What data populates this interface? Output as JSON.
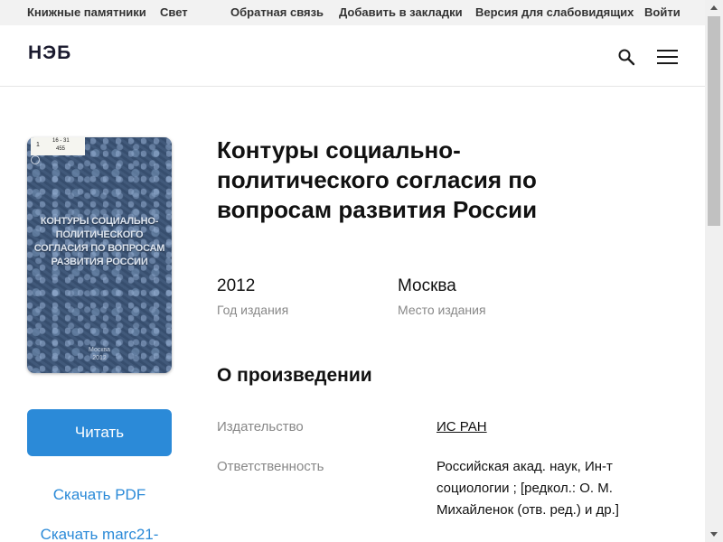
{
  "topbar": {
    "items": [
      "Книжные памятники",
      "Свет",
      "Обратная связь",
      "Добавить в закладки",
      "Версия для слабовидящих",
      "Войти"
    ]
  },
  "header": {
    "logo": "НЭБ",
    "search_icon": "search-icon",
    "menu_icon": "hamburger-menu-icon"
  },
  "cover": {
    "label_num": "1",
    "label_code_top": "16 - 31",
    "label_code_bottom": "455",
    "title": "Контуры социально-политического согласия по вопросам развития России",
    "city": "Москва",
    "year_small": "2012"
  },
  "actions": {
    "read": "Читать",
    "download_pdf": "Скачать PDF",
    "download_marc": "Скачать marc21-"
  },
  "book": {
    "title": "Контуры социально-политического согласия по вопросам развития России",
    "year_value": "2012",
    "year_label": "Год издания",
    "place_value": "Москва",
    "place_label": "Место издания"
  },
  "about": {
    "heading": "О произведении",
    "publisher_label": "Издательство",
    "publisher_value": "ИС РАН",
    "responsibility_label": "Ответственность",
    "responsibility_value": "Российская акад. наук, Ин-т социологии ; [редкол.: О. М. Михайленок (отв. ред.) и др.]"
  },
  "colors": {
    "accent": "#2b8ad8",
    "cover": "#3d5474",
    "label_gray": "#888888"
  }
}
